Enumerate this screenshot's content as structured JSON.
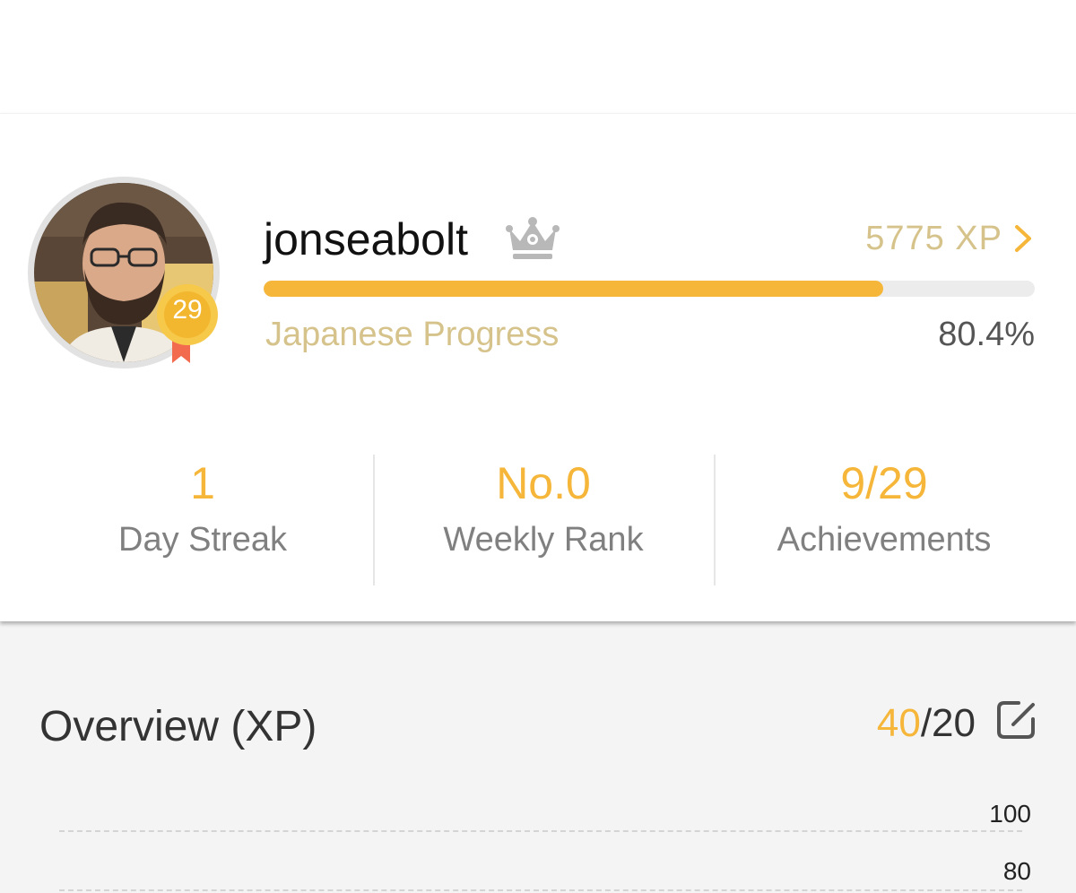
{
  "profile": {
    "username": "jonseabolt",
    "level": "29",
    "xp_total": "5775 XP",
    "progress_label": "Japanese Progress",
    "progress_percent_text": "80.4%",
    "progress_fraction": 0.804,
    "avatar_icon": "user-photo",
    "crown_icon": "crown-icon"
  },
  "stats": [
    {
      "value": "1",
      "label": "Day Streak"
    },
    {
      "value": "No.0",
      "label": "Weekly Rank"
    },
    {
      "value": "9/29",
      "label": "Achievements"
    }
  ],
  "overview": {
    "title": "Overview (XP)",
    "goal_current": "40",
    "goal_separator": "/",
    "goal_target": "20"
  },
  "chart_data": {
    "type": "bar",
    "y_ticks": [
      "100",
      "80"
    ]
  },
  "colors": {
    "accent": "#f5b63a",
    "muted_gold": "#d6c38b",
    "badge_ribbon": "#f26b4f"
  }
}
